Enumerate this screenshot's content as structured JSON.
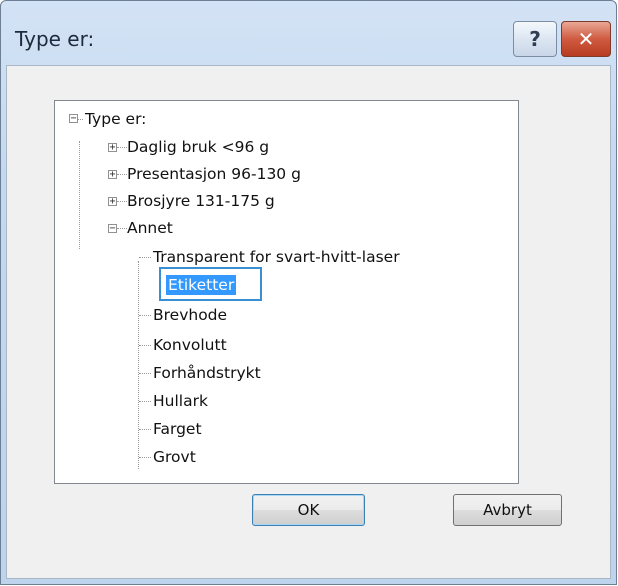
{
  "window": {
    "title": "Type er:"
  },
  "caption": {
    "help_symbol": "?",
    "close_symbol": "✕"
  },
  "tree": {
    "root": "Type er:",
    "items": [
      "Daglig bruk <96 g",
      "Presentasjon 96-130 g",
      "Brosjyre 131-175 g",
      "Annet"
    ],
    "annet_children": [
      "Transparent for svart-hvitt-laser",
      "Etiketter",
      "Brevhode",
      "Konvolutt",
      "Forhåndstrykt",
      "Hullark",
      "Farget",
      "Grovt"
    ],
    "expand_symbol": "+",
    "collapse_symbol": "−"
  },
  "buttons": {
    "ok": "OK",
    "cancel": "Avbryt"
  },
  "colors": {
    "selection": "#3399ff",
    "focus_border": "#3a8fd3"
  }
}
